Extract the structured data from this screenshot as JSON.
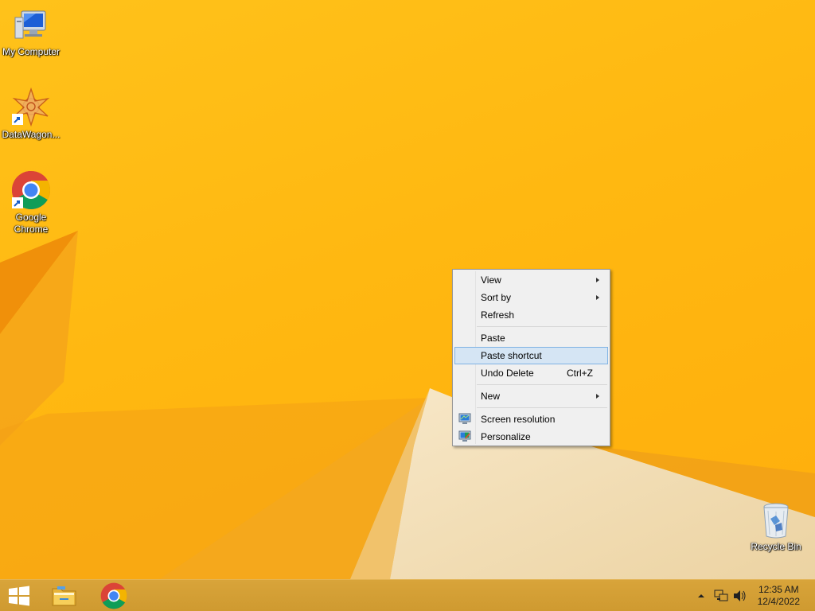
{
  "desktop": {
    "icons": [
      {
        "label": "My Computer"
      },
      {
        "label": "DataWagon..."
      },
      {
        "label": "Google Chrome"
      },
      {
        "label": "Recycle Bin"
      }
    ]
  },
  "context_menu": {
    "items": [
      {
        "label": "View",
        "submenu": true
      },
      {
        "label": "Sort by",
        "submenu": true
      },
      {
        "label": "Refresh"
      },
      {
        "label": "Paste"
      },
      {
        "label": "Paste shortcut",
        "highlighted": true
      },
      {
        "label": "Undo Delete",
        "shortcut": "Ctrl+Z"
      },
      {
        "label": "New",
        "submenu": true
      },
      {
        "label": "Screen resolution",
        "icon": "monitor-icon"
      },
      {
        "label": "Personalize",
        "icon": "personalize-icon"
      }
    ]
  },
  "taskbar": {
    "pinned": [
      {
        "icon": "windows-start-icon"
      },
      {
        "icon": "file-explorer-icon"
      },
      {
        "icon": "chrome-icon"
      }
    ],
    "tray": {
      "icons": [
        "show-hidden-icons-chevron",
        "network-icon",
        "volume-icon"
      ],
      "time": "12:35 AM",
      "date": "12/4/2022"
    }
  },
  "colors": {
    "wallpaper": "#ffb811",
    "taskbar": "#d29e35",
    "menu_highlight": "#d5e5f4"
  }
}
